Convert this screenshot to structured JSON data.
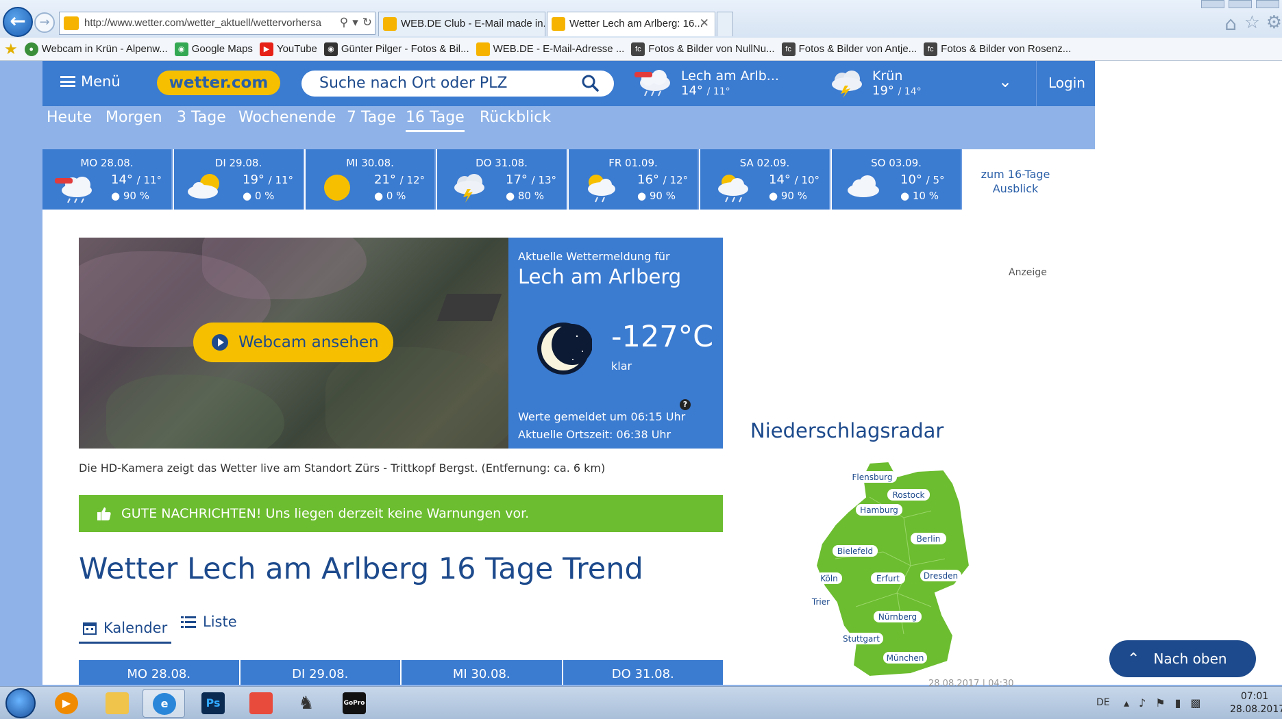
{
  "browser": {
    "url": "http://www.wetter.com/wetter_aktuell/wettervorhersa",
    "tabs": [
      {
        "title": "WEB.DE Club - E-Mail made in..."
      },
      {
        "title": "Wetter Lech am Arlberg: 16..."
      }
    ],
    "bookmarks": [
      {
        "label": "Webcam in Krün - Alpenw...",
        "icon": "globe-icon",
        "color": "#3b8f3b"
      },
      {
        "label": "Google Maps",
        "icon": "maps-pin-icon",
        "color": "#34a853"
      },
      {
        "label": "YouTube",
        "icon": "youtube-icon",
        "color": "#e62117"
      },
      {
        "label": "Günter Pilger - Fotos & Bil...",
        "icon": "camera-icon",
        "color": "#333333"
      },
      {
        "label": "WEB.DE - E-Mail-Adresse ...",
        "icon": "webde-icon",
        "color": "#f6b400"
      },
      {
        "label": "Fotos & Bilder von NullNu...",
        "icon": "fc-icon",
        "color": "#444444"
      },
      {
        "label": "Fotos & Bilder von Antje...",
        "icon": "fc-icon",
        "color": "#444444"
      },
      {
        "label": "Fotos & Bilder von Rosenz...",
        "icon": "fc-icon",
        "color": "#444444"
      }
    ]
  },
  "header": {
    "menu_label": "Menü",
    "logo_text": "wetter.com",
    "search_placeholder": "Suche nach Ort oder PLZ",
    "favorites": [
      {
        "city": "Lech am Arlb...",
        "max": "14°",
        "min": "/ 11°",
        "icon": "rain-icon"
      },
      {
        "city": "Krün",
        "max": "19°",
        "min": "/ 14°",
        "icon": "thunderstorm-icon"
      }
    ],
    "login_label": "Login"
  },
  "subnav": [
    "Heute",
    "Morgen",
    "3 Tage",
    "Wochenende",
    "7 Tage",
    "16 Tage",
    "Rückblick"
  ],
  "subnav_active": "16 Tage",
  "forecast": [
    {
      "day": "MO 28.08.",
      "max": "14°",
      "min": "/ 11°",
      "rain": "90 %",
      "icon": "rain-icon"
    },
    {
      "day": "DI 29.08.",
      "max": "19°",
      "min": "/ 11°",
      "rain": "0 %",
      "icon": "partly-cloudy-icon"
    },
    {
      "day": "MI 30.08.",
      "max": "21°",
      "min": "/ 12°",
      "rain": "0 %",
      "icon": "sun-icon"
    },
    {
      "day": "DO 31.08.",
      "max": "17°",
      "min": "/ 13°",
      "rain": "80 %",
      "icon": "thunderstorm-icon"
    },
    {
      "day": "FR 01.09.",
      "max": "16°",
      "min": "/ 12°",
      "rain": "90 %",
      "icon": "sun-rain-icon"
    },
    {
      "day": "SA 02.09.",
      "max": "14°",
      "min": "/ 10°",
      "rain": "90 %",
      "icon": "sun-rain-icon"
    },
    {
      "day": "SO 03.09.",
      "max": "10°",
      "min": "/ 5°",
      "rain": "10 %",
      "icon": "cloud-icon"
    }
  ],
  "forecast_more": "zum 16-Tage Ausblick",
  "webcam_button": "Webcam ansehen",
  "current": {
    "heading": "Aktuelle Wettermeldung für",
    "city": "Lech am Arlberg",
    "temp": "-127°C",
    "condition": "klar",
    "reported": "Werte gemeldet um 06:15 Uhr",
    "local_time": "Aktuelle Ortszeit: 06:38 Uhr"
  },
  "cam_caption": "Die HD-Kamera zeigt das Wetter live am Standort Zürs - Trittkopf Bergst. (Entfernung: ca. 6 km)",
  "warning": "GUTE NACHRICHTEN! Uns liegen derzeit keine Warnungen vor.",
  "page_title": "Wetter Lech am Arlberg 16 Tage Trend",
  "view_tabs": {
    "calendar": "Kalender",
    "list": "Liste"
  },
  "calendar_days": [
    "MO 28.08.",
    "DI 29.08.",
    "MI 30.08.",
    "DO 31.08."
  ],
  "ad_label": "Anzeige",
  "radar": {
    "title": "Niederschlagsradar",
    "cities": [
      "Flensburg",
      "Rostock",
      "Hamburg",
      "Berlin",
      "Bielefeld",
      "Köln",
      "Erfurt",
      "Dresden",
      "Trier",
      "Nürnberg",
      "Stuttgart",
      "München"
    ],
    "timestamp": "28.08.2017 | 04:30"
  },
  "back_to_top": "Nach oben",
  "taskbar": {
    "lang": "DE",
    "time": "07:01",
    "date": "28.08.2017"
  },
  "colors": {
    "brand_blue": "#3b7bd0",
    "brand_yellow": "#f6c000",
    "good_news_green": "#6cbd2f",
    "navy": "#1d4a8c"
  }
}
